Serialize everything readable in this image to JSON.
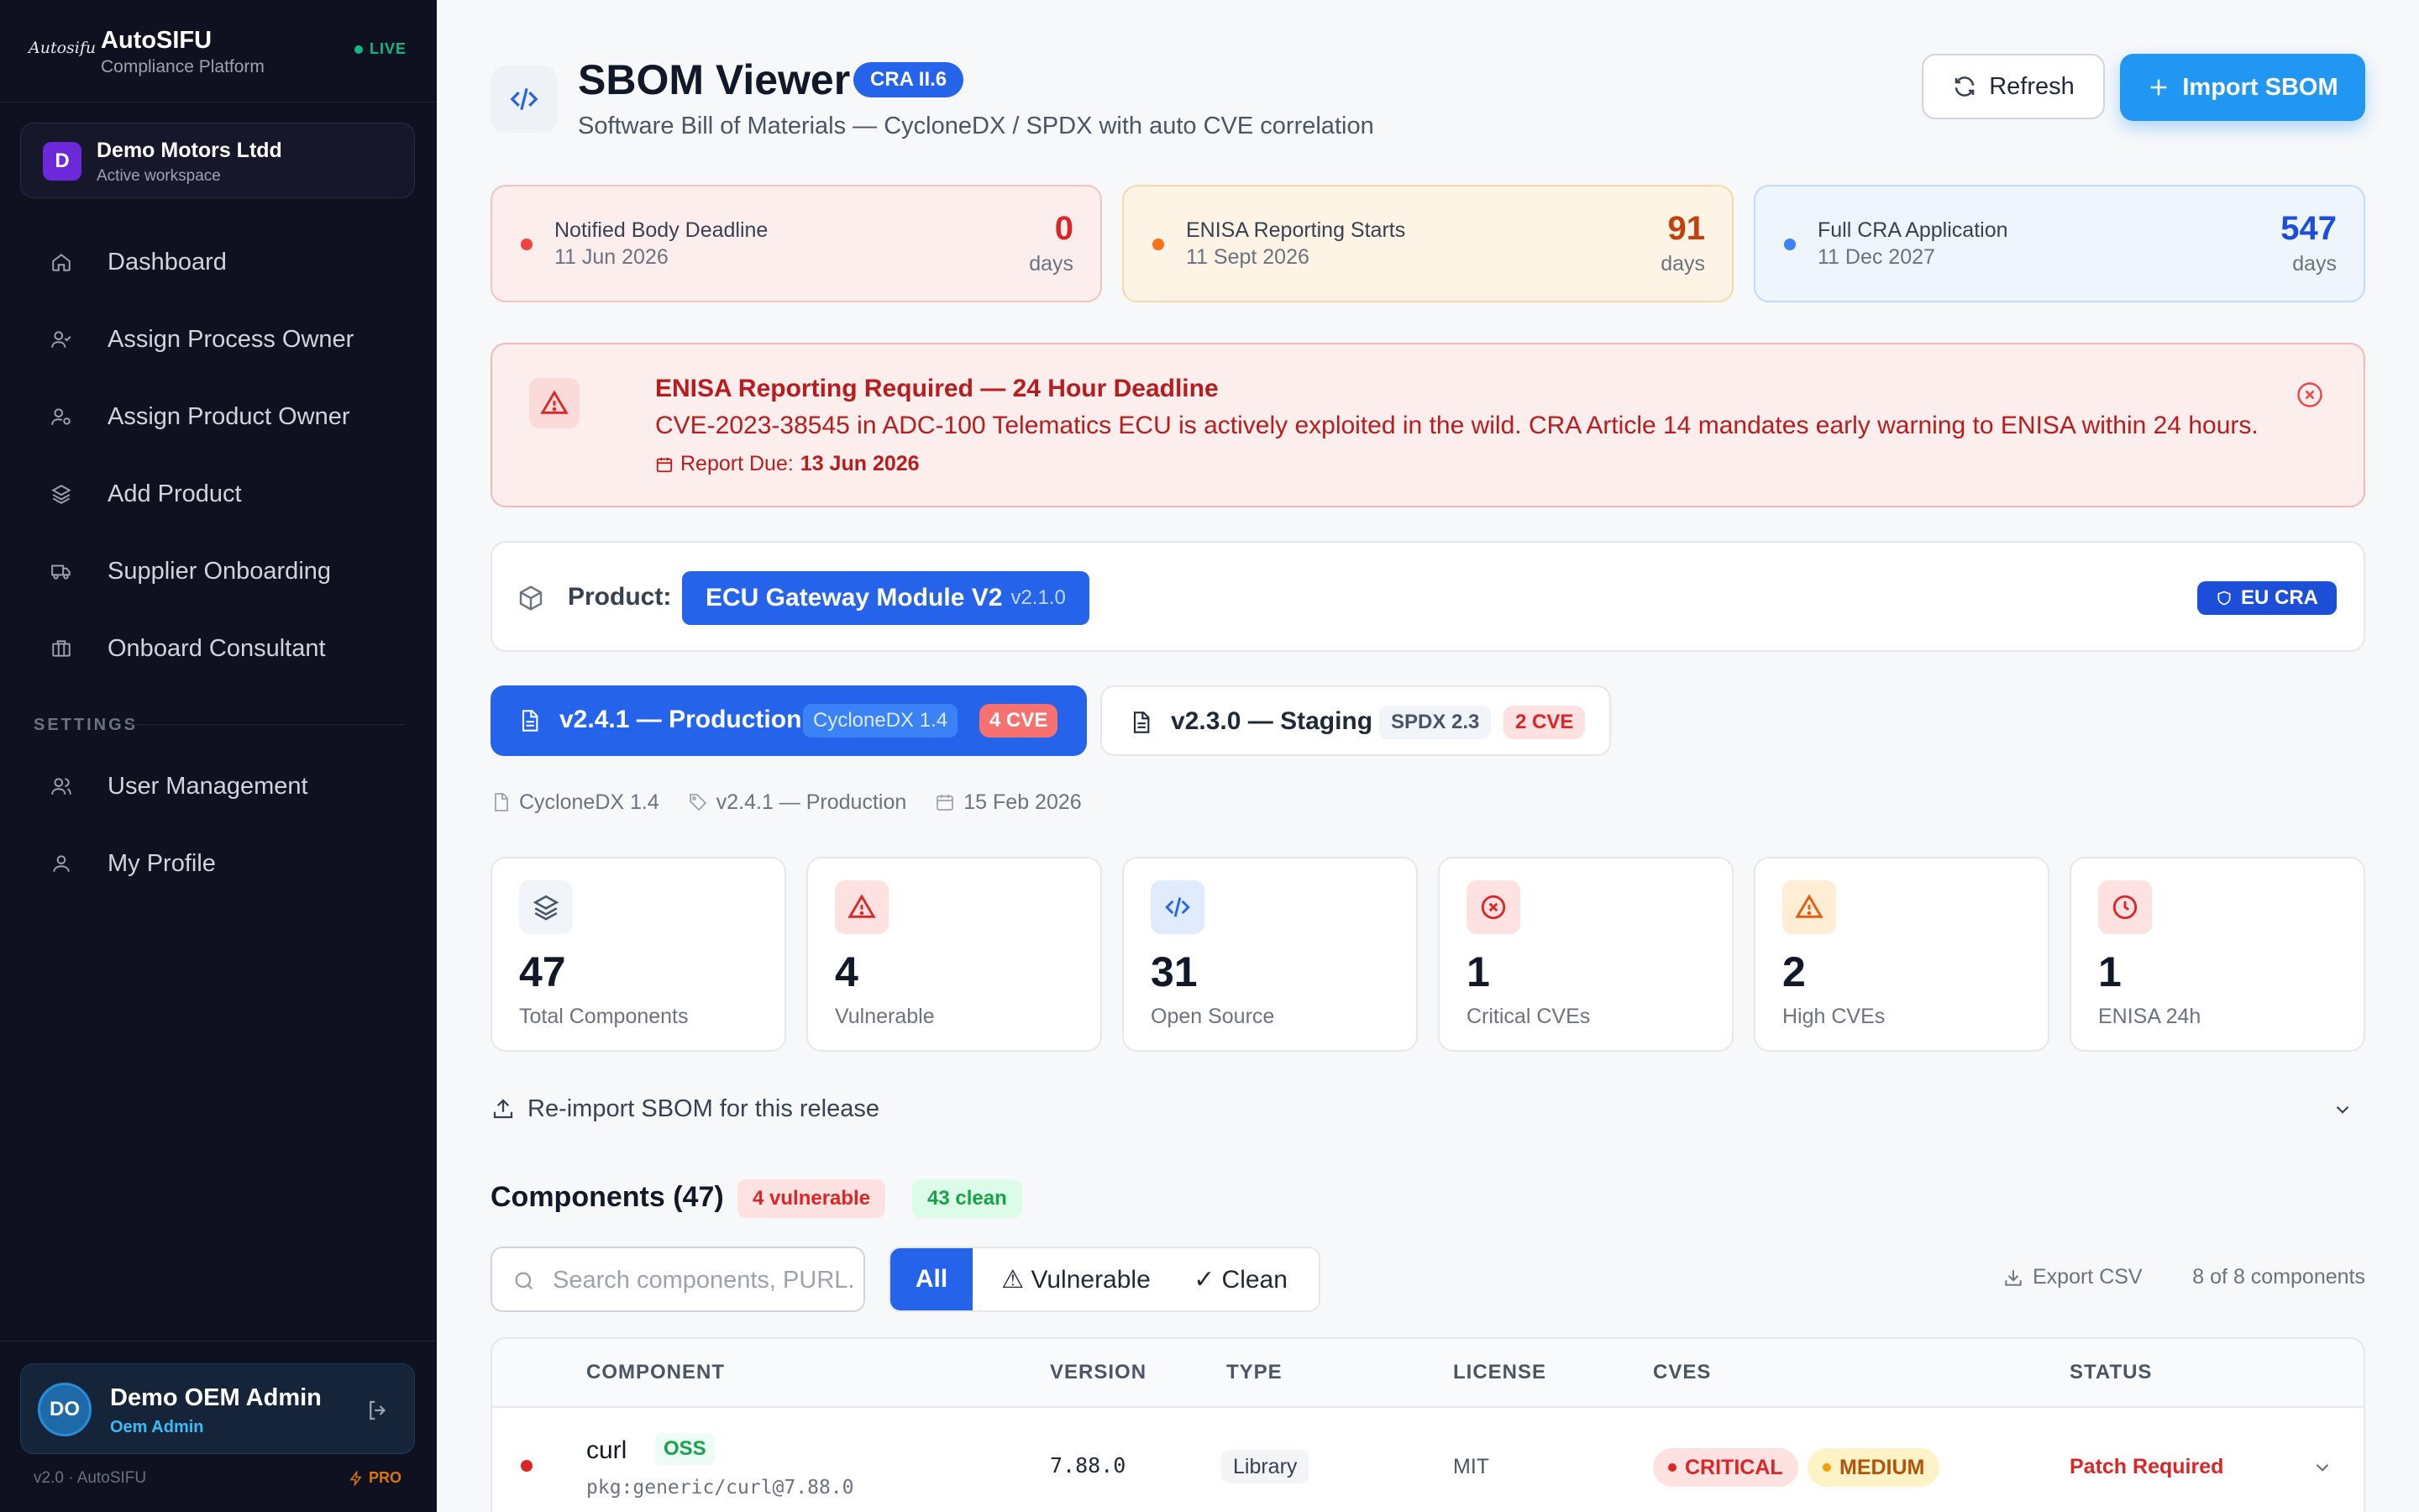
{
  "sidebar": {
    "logo_text": "Autosifu",
    "brand": "AutoSIFU",
    "brand_sub": "Compliance Platform",
    "live": "LIVE",
    "workspace": {
      "initial": "D",
      "name": "Demo Motors Ltdd",
      "sub": "Active workspace"
    },
    "nav": [
      {
        "label": "Dashboard",
        "icon": "home-icon"
      },
      {
        "label": "Assign Process Owner",
        "icon": "user-check-icon"
      },
      {
        "label": "Assign Product Owner",
        "icon": "user-cog-icon"
      },
      {
        "label": "Add Product",
        "icon": "layers-icon"
      },
      {
        "label": "Supplier Onboarding",
        "icon": "truck-icon"
      },
      {
        "label": "Onboard Consultant",
        "icon": "briefcase-icon"
      }
    ],
    "settings_label": "SETTINGS",
    "settings_nav": [
      {
        "label": "User Management",
        "icon": "users-icon"
      },
      {
        "label": "My Profile",
        "icon": "user-icon"
      }
    ],
    "user": {
      "initials": "DO",
      "name": "Demo OEM Admin",
      "role": "Oem Admin"
    },
    "version": "v2.0 · AutoSIFU",
    "pro": "PRO"
  },
  "header": {
    "title": "SBOM Viewer",
    "badge": "CRA II.6",
    "subtitle": "Software Bill of Materials — CycloneDX / SPDX with auto CVE correlation",
    "refresh_label": "Refresh",
    "import_label": "Import SBOM"
  },
  "deadlines": [
    {
      "title": "Notified Body Deadline",
      "date": "11 Jun 2026",
      "value": "0",
      "unit": "days",
      "color": "#dc2626"
    },
    {
      "title": "ENISA Reporting Starts",
      "date": "11 Sept 2026",
      "value": "91",
      "unit": "days",
      "color": "#ea580c"
    },
    {
      "title": "Full CRA Application",
      "date": "11 Dec 2027",
      "value": "547",
      "unit": "days",
      "color": "#2563eb"
    }
  ],
  "alert": {
    "title": "ENISA Reporting Required — 24 Hour Deadline",
    "text": "CVE-2023-38545 in ADC-100 Telematics ECU is actively exploited in the wild. CRA Article 14 mandates early warning to ENISA within 24 hours.",
    "due_label": "Report Due:",
    "due_date": "13 Jun 2026"
  },
  "product": {
    "label": "Product:",
    "name": "ECU Gateway Module V2",
    "version": "v2.1.0",
    "badge": "EU CRA"
  },
  "releases": [
    {
      "name": "v2.4.1 — Production",
      "format": "CycloneDX 1.4",
      "cves": "4 CVE"
    },
    {
      "name": "v2.3.0 — Staging",
      "format": "SPDX 2.3",
      "cves": "2 CVE"
    }
  ],
  "meta": {
    "format": "CycloneDX 1.4",
    "release": "v2.4.1 — Production",
    "date": "15 Feb 2026"
  },
  "stats": [
    {
      "value": "47",
      "label": "Total Components",
      "icon": "layers-icon"
    },
    {
      "value": "4",
      "label": "Vulnerable",
      "icon": "warning-icon"
    },
    {
      "value": "31",
      "label": "Open Source",
      "icon": "code-icon"
    },
    {
      "value": "1",
      "label": "Critical CVEs",
      "icon": "x-circle-icon"
    },
    {
      "value": "2",
      "label": "High CVEs",
      "icon": "warning-icon"
    },
    {
      "value": "1",
      "label": "ENISA 24h",
      "icon": "clock-icon"
    }
  ],
  "reimport_label": "Re-import SBOM for this release",
  "components": {
    "title": "Components (47)",
    "vulnerable_pill": "4 vulnerable",
    "clean_pill": "43 clean",
    "search_placeholder": "Search components, PURL...",
    "filters": [
      "All",
      "⚠ Vulnerable",
      "✓ Clean"
    ],
    "export_label": "Export CSV",
    "count_text": "8 of 8 components",
    "columns": [
      "COMPONENT",
      "VERSION",
      "TYPE",
      "LICENSE",
      "CVES",
      "STATUS"
    ],
    "rows": [
      {
        "name": "curl",
        "tag": "OSS",
        "purl": "pkg:generic/curl@7.88.0",
        "version": "7.88.0",
        "type": "Library",
        "license": "MIT",
        "cves": [
          "CRITICAL",
          "MEDIUM"
        ],
        "status": "Patch Required"
      }
    ]
  }
}
